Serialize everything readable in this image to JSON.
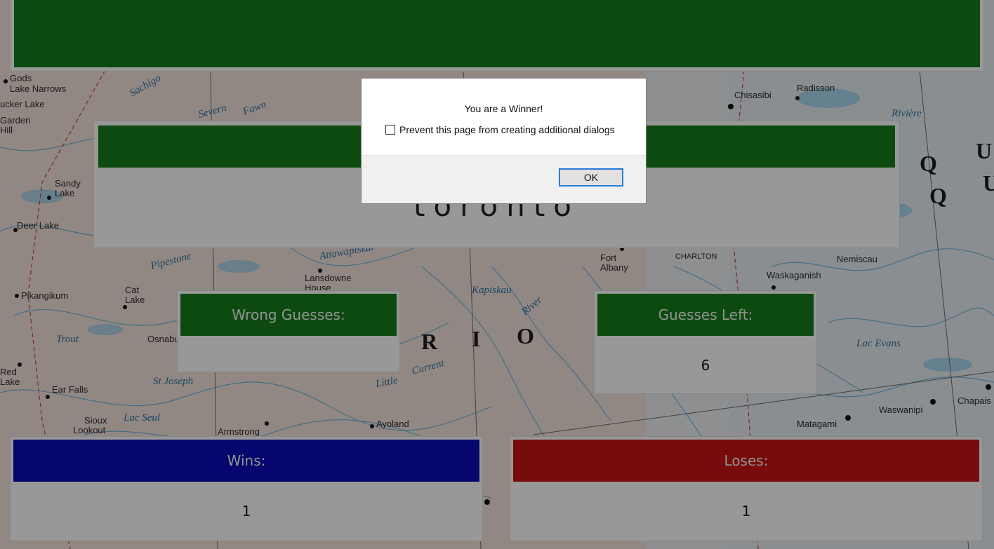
{
  "game": {
    "word": "toronto",
    "wrong_guesses_label": "Wrong Guesses:",
    "wrong_guesses_value": "",
    "guesses_left_label": "Guesses Left:",
    "guesses_left_value": "6",
    "wins_label": "Wins:",
    "wins_value": "1",
    "loses_label": "Loses:",
    "loses_value": "1"
  },
  "dialog": {
    "message": "You are a Winner!",
    "checkbox_label": "Prevent this page from creating additional dialogs",
    "checkbox_checked": false,
    "ok_label": "OK"
  },
  "map_labels": [
    "Gods",
    "Lake Narrows",
    "Sucker Lake",
    "Garden Hill",
    "Sandy Lake",
    "Deer Lake",
    "Pikangikum",
    "Cat Lake",
    "Red Lake",
    "Ear Falls",
    "Sioux Lookout",
    "Armstrong",
    "Lansdowne House",
    "Ayoland",
    "Fort Albany",
    "CHARLTON",
    "Waskaganish",
    "Nemiscau",
    "Chisasibi",
    "Radisson",
    "Matagami",
    "Waswanipi",
    "Chapais",
    "Osnaburgh"
  ],
  "map_water_labels": [
    "Sachigo",
    "Severn",
    "Fawn",
    "Pipestone",
    "Attawapiskat",
    "Kapiskau",
    "River",
    "Current",
    "Little",
    "Lac Seul",
    "St Joseph",
    "Trout L.",
    "Rivière",
    "Lac Evans"
  ],
  "map_big_letters": [
    "R",
    "I",
    "O",
    "Q",
    "U",
    "Q",
    "U"
  ]
}
